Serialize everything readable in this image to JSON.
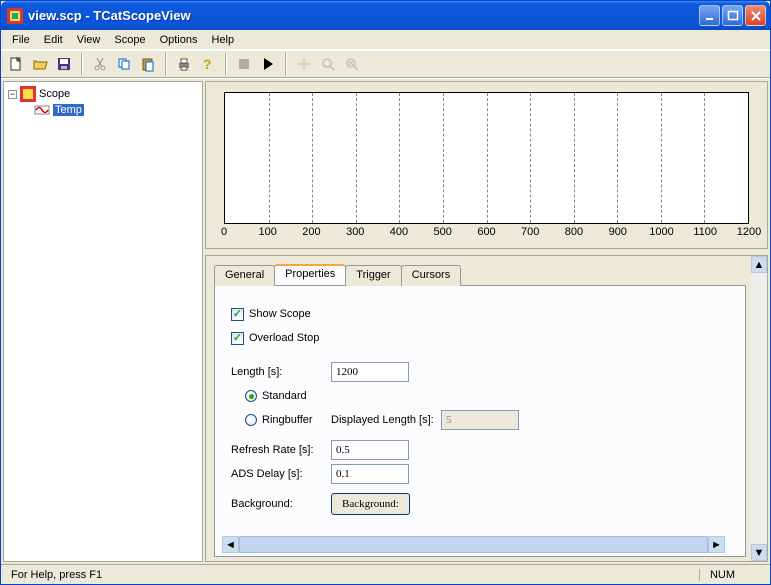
{
  "window": {
    "title": "view.scp - TCatScopeView"
  },
  "menu": [
    "File",
    "Edit",
    "View",
    "Scope",
    "Options",
    "Help"
  ],
  "tree": {
    "root": "Scope",
    "child": "Temp"
  },
  "chart_data": {
    "type": "line",
    "series": [],
    "x_ticks": [
      0,
      100,
      200,
      300,
      400,
      500,
      600,
      700,
      800,
      900,
      1000,
      1100,
      1200
    ],
    "xlim": [
      0,
      1200
    ],
    "title": "",
    "xlabel": "",
    "ylabel": ""
  },
  "tabs": [
    "General",
    "Properties",
    "Trigger",
    "Cursors"
  ],
  "active_tab": "Properties",
  "properties": {
    "show_scope": {
      "label": "Show Scope",
      "checked": true
    },
    "overload_stop": {
      "label": "Overload Stop",
      "checked": true
    },
    "length": {
      "label": "Length [s]:",
      "value": "1200"
    },
    "mode_standard": {
      "label": "Standard",
      "checked": true
    },
    "mode_ringbuffer": {
      "label": "Ringbuffer",
      "checked": false
    },
    "displayed_length": {
      "label": "Displayed Length [s]:",
      "value": "5",
      "enabled": false
    },
    "refresh_rate": {
      "label": "Refresh Rate [s]:",
      "value": "0.5"
    },
    "ads_delay": {
      "label": "ADS Delay [s]:",
      "value": "0.1"
    },
    "background": {
      "label": "Background:",
      "button": "Background:"
    }
  },
  "status": {
    "help": "For Help, press F1",
    "num": "NUM"
  }
}
